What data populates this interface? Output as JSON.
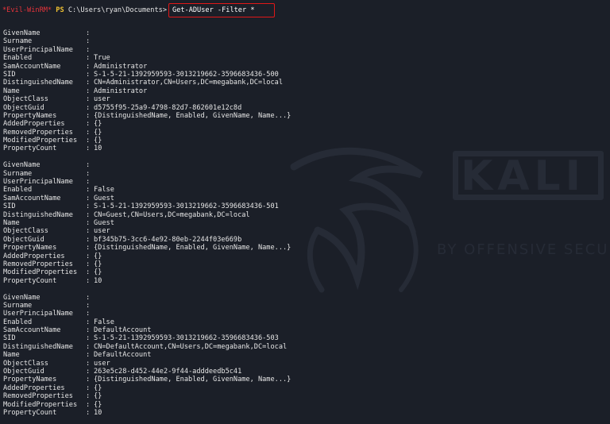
{
  "prompt": {
    "evil_label": "*Evil-WinRM*",
    "ps_label": "PS",
    "path": "C:\\Users\\ryan\\Documents>",
    "command": "Get-ADUser -Filter *"
  },
  "watermark": {
    "brand": "KALI",
    "tagline": "BY OFFENSIVE SECURITY"
  },
  "separator": ":",
  "records": [
    {
      "fields": [
        {
          "key": "GivenName",
          "value": ""
        },
        {
          "key": "Surname",
          "value": ""
        },
        {
          "key": "UserPrincipalName",
          "value": ""
        },
        {
          "key": "Enabled",
          "value": "True"
        },
        {
          "key": "SamAccountName",
          "value": "Administrator"
        },
        {
          "key": "SID",
          "value": "S-1-5-21-1392959593-3013219662-3596683436-500"
        },
        {
          "key": "DistinguishedName",
          "value": "CN=Administrator,CN=Users,DC=megabank,DC=local"
        },
        {
          "key": "Name",
          "value": "Administrator"
        },
        {
          "key": "ObjectClass",
          "value": "user"
        },
        {
          "key": "ObjectGuid",
          "value": "d5755f95-25a9-4798-82d7-862601e12c8d"
        },
        {
          "key": "PropertyNames",
          "value": "{DistinguishedName, Enabled, GivenName, Name...}"
        },
        {
          "key": "AddedProperties",
          "value": "{}"
        },
        {
          "key": "RemovedProperties",
          "value": "{}"
        },
        {
          "key": "ModifiedProperties",
          "value": "{}"
        },
        {
          "key": "PropertyCount",
          "value": "10"
        }
      ]
    },
    {
      "fields": [
        {
          "key": "GivenName",
          "value": ""
        },
        {
          "key": "Surname",
          "value": ""
        },
        {
          "key": "UserPrincipalName",
          "value": ""
        },
        {
          "key": "Enabled",
          "value": "False"
        },
        {
          "key": "SamAccountName",
          "value": "Guest"
        },
        {
          "key": "SID",
          "value": "S-1-5-21-1392959593-3013219662-3596683436-501"
        },
        {
          "key": "DistinguishedName",
          "value": "CN=Guest,CN=Users,DC=megabank,DC=local"
        },
        {
          "key": "Name",
          "value": "Guest"
        },
        {
          "key": "ObjectClass",
          "value": "user"
        },
        {
          "key": "ObjectGuid",
          "value": "bf345b75-3cc6-4e92-80eb-2244f03e669b"
        },
        {
          "key": "PropertyNames",
          "value": "{DistinguishedName, Enabled, GivenName, Name...}"
        },
        {
          "key": "AddedProperties",
          "value": "{}"
        },
        {
          "key": "RemovedProperties",
          "value": "{}"
        },
        {
          "key": "ModifiedProperties",
          "value": "{}"
        },
        {
          "key": "PropertyCount",
          "value": "10"
        }
      ]
    },
    {
      "fields": [
        {
          "key": "GivenName",
          "value": ""
        },
        {
          "key": "Surname",
          "value": ""
        },
        {
          "key": "UserPrincipalName",
          "value": ""
        },
        {
          "key": "Enabled",
          "value": "False"
        },
        {
          "key": "SamAccountName",
          "value": "DefaultAccount"
        },
        {
          "key": "SID",
          "value": "S-1-5-21-1392959593-3013219662-3596683436-503"
        },
        {
          "key": "DistinguishedName",
          "value": "CN=DefaultAccount,CN=Users,DC=megabank,DC=local"
        },
        {
          "key": "Name",
          "value": "DefaultAccount"
        },
        {
          "key": "ObjectClass",
          "value": "user"
        },
        {
          "key": "ObjectGuid",
          "value": "263e5c28-d452-44e2-9f44-adddeedb5c41"
        },
        {
          "key": "PropertyNames",
          "value": "{DistinguishedName, Enabled, GivenName, Name...}"
        },
        {
          "key": "AddedProperties",
          "value": "{}"
        },
        {
          "key": "RemovedProperties",
          "value": "{}"
        },
        {
          "key": "ModifiedProperties",
          "value": "{}"
        },
        {
          "key": "PropertyCount",
          "value": "10"
        }
      ]
    }
  ]
}
